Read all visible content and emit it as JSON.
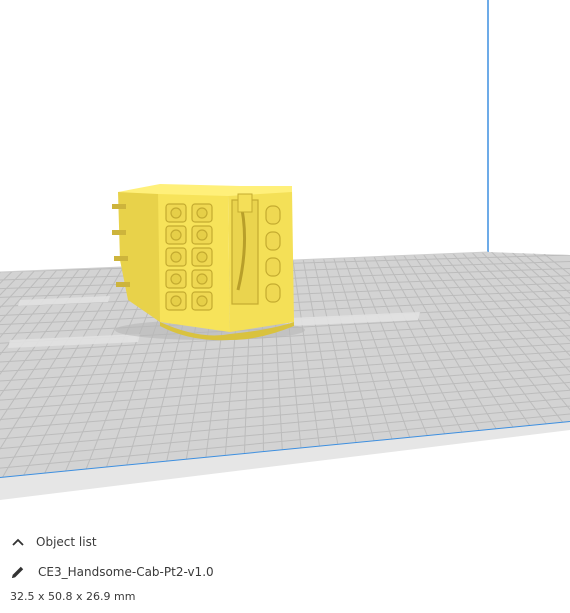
{
  "viewport": {
    "bed_color": "#d2d2d2",
    "grid_color": "#bdbdbd",
    "model_color": "#f7e45c",
    "axis_blue": "#3d8fe0"
  },
  "object_panel": {
    "toggle_label": "Object list",
    "toggle_icon": "chevron-up-icon",
    "edit_icon": "pencil-icon",
    "object_name": "CE3_Handsome-Cab-Pt2-v1.0",
    "dimensions": "32.5 x 50.8 x 26.9 mm"
  }
}
